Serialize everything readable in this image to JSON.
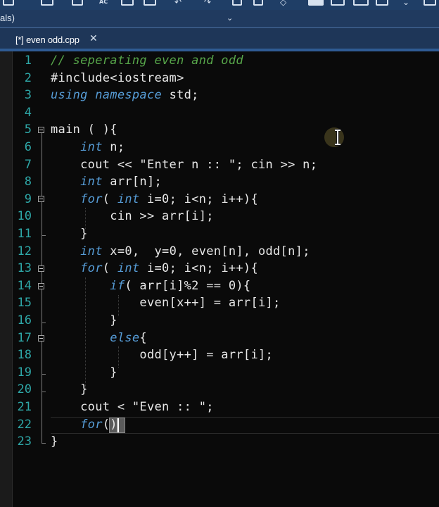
{
  "scope": {
    "label": "als)"
  },
  "tab": {
    "label": "[*] even odd.cpp",
    "close": "✕"
  },
  "toolbar": {
    "ac_label": "AC"
  },
  "lines": [
    {
      "num": "1",
      "html": "<span class='cm'>// seperating even and odd</span>"
    },
    {
      "num": "2",
      "html": "#include&lt;iostream&gt;"
    },
    {
      "num": "3",
      "html": "<span class='kw'>using namespace</span> std;"
    },
    {
      "num": "4",
      "html": ""
    },
    {
      "num": "5",
      "html": "main ( ){"
    },
    {
      "num": "6",
      "html": "    <span class='kw'>int</span> n;"
    },
    {
      "num": "7",
      "html": "    cout &lt;&lt; \"Enter n :: \"; cin &gt;&gt; n;"
    },
    {
      "num": "8",
      "html": "    <span class='kw'>int</span> arr[n];"
    },
    {
      "num": "9",
      "html": "    <span class='kw'>for</span>( <span class='kw'>int</span> i=0; i&lt;n; i++){"
    },
    {
      "num": "10",
      "html": "        cin &gt;&gt; arr[i];"
    },
    {
      "num": "11",
      "html": "    }"
    },
    {
      "num": "12",
      "html": "    <span class='kw'>int</span> x=0,  y=0, even[n], odd[n];"
    },
    {
      "num": "13",
      "html": "    <span class='kw'>for</span>( <span class='kw'>int</span> i=0; i&lt;n; i++){"
    },
    {
      "num": "14",
      "html": "        <span class='kw'>if</span>( arr[i]%2 == 0){"
    },
    {
      "num": "15",
      "html": "            even[x++] = arr[i];"
    },
    {
      "num": "16",
      "html": "        }"
    },
    {
      "num": "17",
      "html": "        <span class='kw'>else</span>{"
    },
    {
      "num": "18",
      "html": "            odd[y++] = arr[i];"
    },
    {
      "num": "19",
      "html": "        }"
    },
    {
      "num": "20",
      "html": "    }"
    },
    {
      "num": "21",
      "html": "    cout &lt; \"Even :: \";"
    },
    {
      "num": "22",
      "html": "    <span class='kw'>for</span>()"
    },
    {
      "num": "23",
      "html": "}"
    }
  ]
}
